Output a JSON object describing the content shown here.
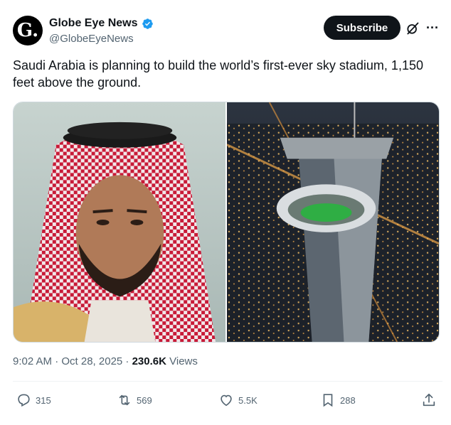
{
  "author": {
    "avatar_letter": "G.",
    "display_name": "Globe Eye News",
    "handle": "@GlobeEyeNews",
    "verified_color": "#1d9bf0"
  },
  "header": {
    "subscribe_label": "Subscribe",
    "grok_icon": "grok-icon",
    "more_icon": "more-icon"
  },
  "tweet": {
    "text": "Saudi Arabia is planning to build the world’s first-ever sky stadium, 1,150 feet above the ground."
  },
  "media": {
    "photos": [
      "portrait-photo",
      "sky-stadium-photo"
    ]
  },
  "meta": {
    "timestamp": "9:02 AM · Oct 28, 2025 · ",
    "views_count": "230.6K",
    "views_label": " Views"
  },
  "actions": {
    "replies": "315",
    "reposts": "569",
    "likes": "5.5K",
    "bookmarks": "288"
  },
  "colors": {
    "text_primary": "#0f1419",
    "text_secondary": "#536471",
    "accent": "#1d9bf0"
  }
}
